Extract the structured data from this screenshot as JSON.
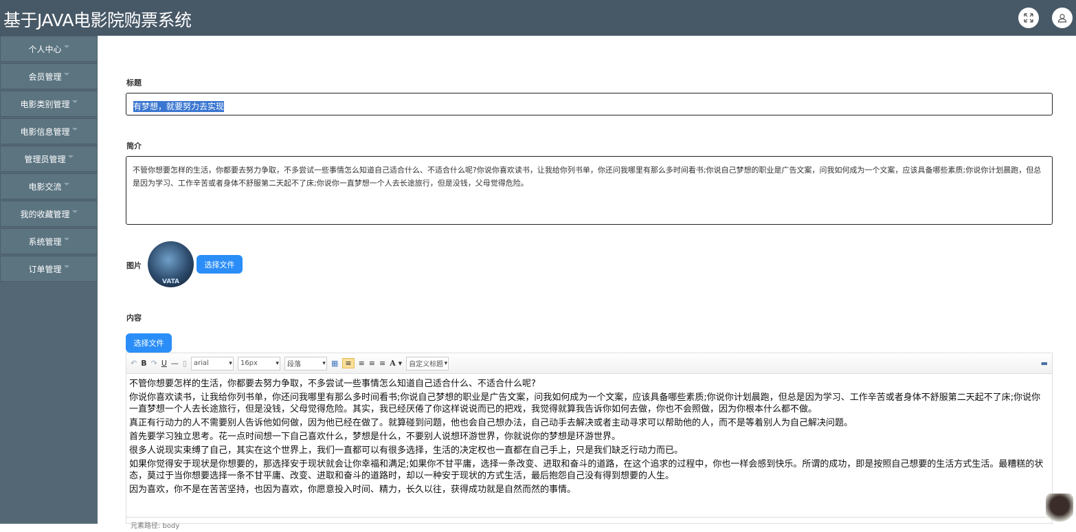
{
  "header": {
    "title": "基于JAVA电影院购票系统",
    "fullscreen_icon": "expand-icon",
    "user_icon": "user-icon"
  },
  "sidebar": {
    "items": [
      {
        "label": "个人中心"
      },
      {
        "label": "会员管理"
      },
      {
        "label": "电影类别管理"
      },
      {
        "label": "电影信息管理"
      },
      {
        "label": "管理员管理"
      },
      {
        "label": "电影交流"
      },
      {
        "label": "我的收藏管理"
      },
      {
        "label": "系统管理"
      },
      {
        "label": "订单管理"
      }
    ]
  },
  "form": {
    "title_label": "标题",
    "title_value": "有梦想，就要努力去实现",
    "intro_label": "简介",
    "intro_value": "不管你想要怎样的生活，你都要去努力争取，不多尝试一些事情怎么知道自己适合什么、不适合什么呢?你说你喜欢读书，让我给你列书单，你还问我哪里有那么多时间看书;你说自己梦想的职业是广告文案，问我如何成为一个文案，应该具备哪些素质;你说你计划晨跑，但总是因为学习、工作辛苦或者身体不舒服第二天起不了床;你说你一直梦想一个人去长途旅行，但是没钱，父母觉得危险。",
    "image_label": "图片",
    "image_caption": "VATA",
    "image_button": "选择文件",
    "content_label": "内容",
    "content_button": "选择文件"
  },
  "editor": {
    "toolbar": {
      "font": "arial",
      "size": "16px",
      "paragraph": "段落",
      "custom_title": "自定义标题"
    },
    "paragraphs": [
      "不管你想要怎样的生活，你都要去努力争取，不多尝试一些事情怎么知道自己适合什么、不适合什么呢?",
      "你说你喜欢读书，让我给你列书单，你还问我哪里有那么多时间看书;你说自己梦想的职业是广告文案，问我如何成为一个文案，应该具备哪些素质;你说你计划晨跑，但总是因为学习、工作辛苦或者身体不舒服第二天起不了床;你说你一直梦想一个人去长途旅行，但是没钱，父母觉得危险。其实，我已经厌倦了你这样说说而已的把戏，我觉得就算我告诉你如何去做，你也不会照做，因为你根本什么都不做。",
      "真正有行动力的人不需要别人告诉他如何做，因为他已经在做了。就算碰到问题，他也会自己想办法，自己动手去解决或者主动寻求可以帮助他的人，而不是等着别人为自己解决问题。",
      "首先要学习独立思考。花一点时间想一下自己喜欢什么，梦想是什么，不要别人说想环游世界，你就说你的梦想是环游世界。",
      "很多人说现实束缚了自己，其实在这个世界上，我们一直都可以有很多选择，生活的决定权也一直都在自己手上，只是我们缺乏行动力而已。",
      "如果你觉得安于现状是你想要的，那选择安于现状就会让你幸福和满足;如果你不甘平庸，选择一条改变、进取和奋斗的道路，在这个追求的过程中，你也一样会感到快乐。所谓的成功，即是按照自己想要的生活方式生活。最糟糕的状态，莫过于当你想要选择一条不甘平庸、改变、进取和奋斗的道路时，却以一种安于现状的方式生活，最后抱怨自己没有得到想要的人生。",
      "因为喜欢，你不是在苦苦坚持，也因为喜欢，你愿意投入时间、精力，长久以往，获得成功就是自然而然的事情。"
    ],
    "path": "元素路径: body"
  }
}
